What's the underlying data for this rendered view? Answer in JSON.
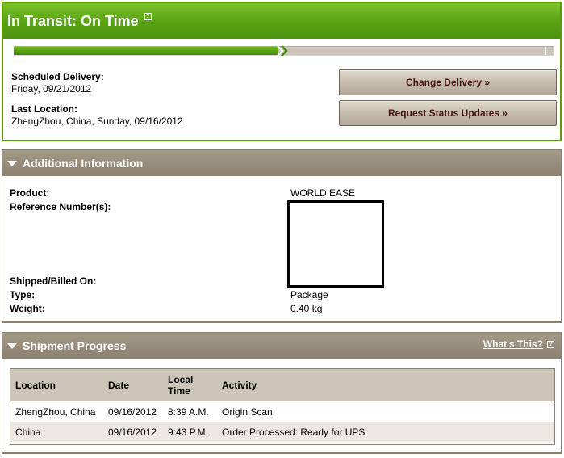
{
  "status": {
    "title": "In Transit: On Time",
    "help_glyph": "?",
    "progress_fraction": 0.49
  },
  "delivery": {
    "scheduled_label": "Scheduled Delivery:",
    "scheduled_value": "Friday, 09/21/2012",
    "last_location_label": "Last Location:",
    "last_location_value": "ZhengZhou, China, Sunday, 09/16/2012"
  },
  "buttons": {
    "change_delivery": "Change Delivery »",
    "request_updates": "Request Status Updates »"
  },
  "additional_info": {
    "title": "Additional Information",
    "product_label": "Product:",
    "product_value": "WORLD EASE",
    "reference_label": "Reference Number(s):",
    "shipped_label": "Shipped/Billed On:",
    "type_label": "Type:",
    "type_value": "Package",
    "weight_label": "Weight:",
    "weight_value": "0.40 kg"
  },
  "shipment_progress": {
    "title": "Shipment Progress",
    "whats_this": "What's This?",
    "columns": {
      "location": "Location",
      "date": "Date",
      "local_time_1": "Local",
      "local_time_2": "Time",
      "activity": "Activity"
    },
    "rows": [
      {
        "location": "ZhengZhou, China",
        "date": "09/16/2012",
        "time": "8:39 A.M.",
        "activity": "Origin Scan"
      },
      {
        "location": "China",
        "date": "09/16/2012",
        "time": "9:43 P.M.",
        "activity": "Order Processed: Ready for UPS"
      }
    ]
  },
  "colors": {
    "brand_green": "#5aa114",
    "panel_brown": "#8c8170",
    "button_text": "#4a1414"
  }
}
